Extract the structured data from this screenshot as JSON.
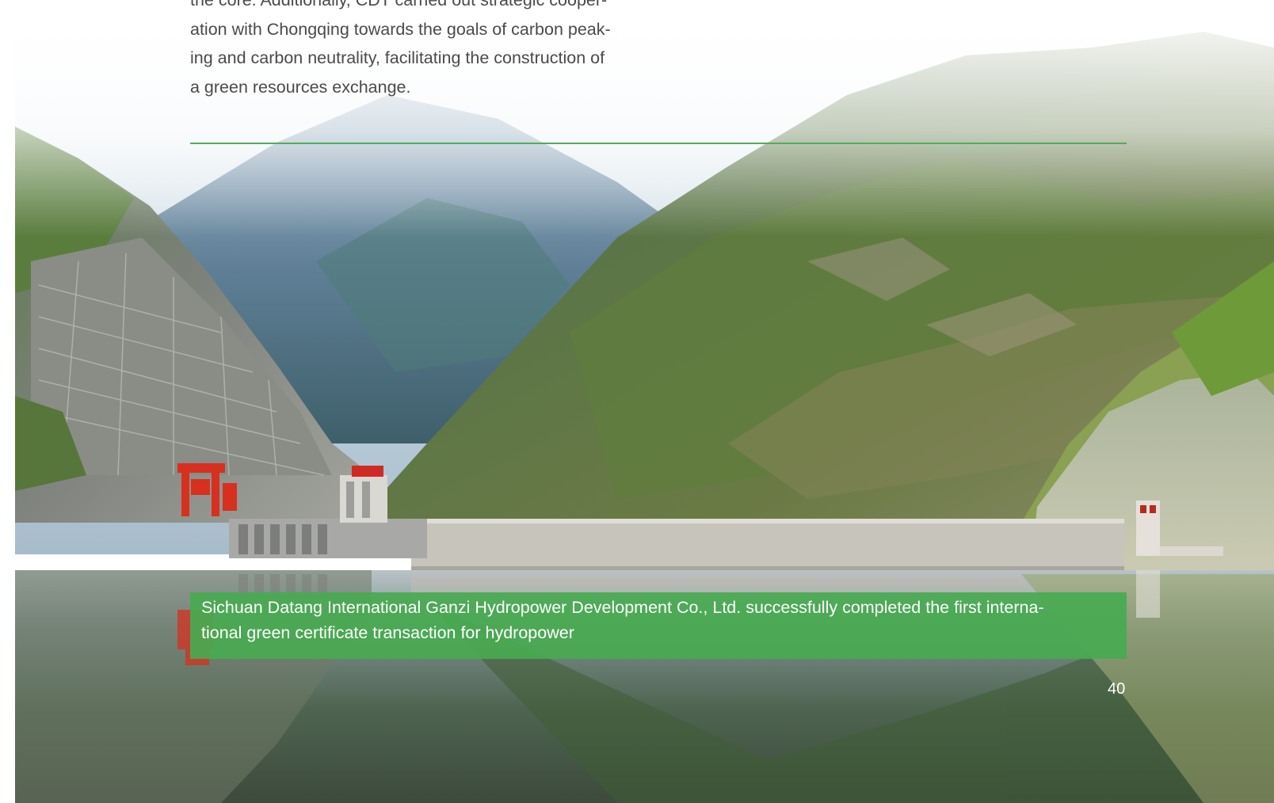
{
  "body_text": "the core. Additionally, CDT carried out strategic cooper-\nation with Chongqing towards the goals of carbon peak-\ning and carbon neutrality, facilitating the construction of\na green resources exchange.",
  "caption": "Sichuan Datang International Ganzi Hydropower Development Co., Ltd. successfully completed the first interna-\ntional green certificate transaction for hydropower",
  "page_number": "40",
  "colors": {
    "accent_green": "#4fae5a",
    "caption_bg": "#48aa50",
    "body_text": "#4a4a4a"
  }
}
